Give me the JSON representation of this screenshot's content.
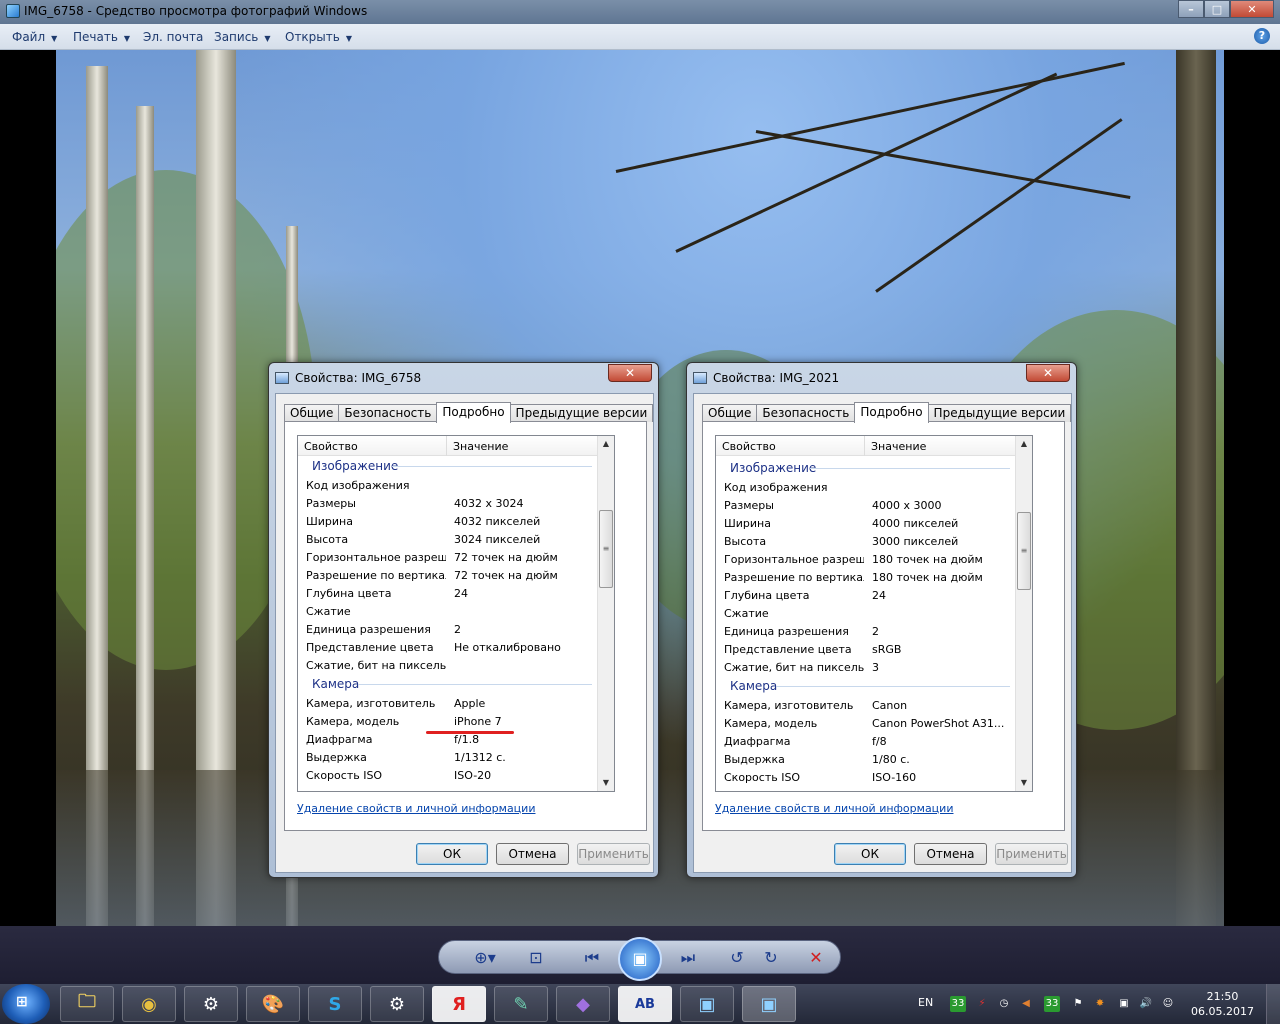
{
  "window": {
    "title": "IMG_6758 - Средство просмотра фотографий Windows",
    "controls": {
      "minimize": "–",
      "maximize": "□",
      "close": "✕"
    }
  },
  "menu": {
    "items": [
      {
        "label": "Файл",
        "has_arrow": true
      },
      {
        "label": "Печать",
        "has_arrow": true
      },
      {
        "label": "Эл. почта",
        "has_arrow": false
      },
      {
        "label": "Запись",
        "has_arrow": true
      },
      {
        "label": "Открыть",
        "has_arrow": true
      }
    ],
    "arrow_glyph": "▼",
    "help": "?"
  },
  "dialogs": [
    {
      "title": "Свойства: IMG_6758",
      "close": "✕",
      "tabs": [
        "Общие",
        "Безопасность",
        "Подробно",
        "Предыдущие версии"
      ],
      "active_tab": "Подробно",
      "columns": {
        "property": "Свойство",
        "value": "Значение"
      },
      "groups": [
        {
          "name": "Изображение",
          "rows": [
            {
              "k": "Код изображения",
              "v": ""
            },
            {
              "k": "Размеры",
              "v": "4032 x 3024"
            },
            {
              "k": "Ширина",
              "v": "4032 пикселей"
            },
            {
              "k": "Высота",
              "v": "3024 пикселей"
            },
            {
              "k": "Горизонтальное разреше...",
              "v": "72 точек на дюйм"
            },
            {
              "k": "Разрешение по вертикали",
              "v": "72 точек на дюйм"
            },
            {
              "k": "Глубина цвета",
              "v": "24"
            },
            {
              "k": "Сжатие",
              "v": ""
            },
            {
              "k": "Единица разрешения",
              "v": "2"
            },
            {
              "k": "Представление цвета",
              "v": "Не откалибровано"
            },
            {
              "k": "Сжатие, бит на пиксель",
              "v": ""
            }
          ]
        },
        {
          "name": "Камера",
          "rows": [
            {
              "k": "Камера, изготовитель",
              "v": "Apple"
            },
            {
              "k": "Камера, модель",
              "v": "iPhone 7"
            },
            {
              "k": "Диафрагма",
              "v": "f/1.8"
            },
            {
              "k": "Выдержка",
              "v": "1/1312 с."
            },
            {
              "k": "Скорость ISO",
              "v": "ISO-20"
            }
          ]
        }
      ],
      "link": "Удаление свойств и личной информации",
      "buttons": {
        "ok": "ОК",
        "cancel": "Отмена",
        "apply": "Применить"
      }
    },
    {
      "title": "Свойства: IMG_2021",
      "close": "✕",
      "tabs": [
        "Общие",
        "Безопасность",
        "Подробно",
        "Предыдущие версии"
      ],
      "active_tab": "Подробно",
      "columns": {
        "property": "Свойство",
        "value": "Значение"
      },
      "groups": [
        {
          "name": "Изображение",
          "rows": [
            {
              "k": "Код изображения",
              "v": ""
            },
            {
              "k": "Размеры",
              "v": "4000 x 3000"
            },
            {
              "k": "Ширина",
              "v": "4000 пикселей"
            },
            {
              "k": "Высота",
              "v": "3000 пикселей"
            },
            {
              "k": "Горизонтальное разреше...",
              "v": "180 точек на дюйм"
            },
            {
              "k": "Разрешение по вертикали",
              "v": "180 точек на дюйм"
            },
            {
              "k": "Глубина цвета",
              "v": "24"
            },
            {
              "k": "Сжатие",
              "v": ""
            },
            {
              "k": "Единица разрешения",
              "v": "2"
            },
            {
              "k": "Представление цвета",
              "v": "sRGB"
            },
            {
              "k": "Сжатие, бит на пиксель",
              "v": "3"
            }
          ]
        },
        {
          "name": "Камера",
          "rows": [
            {
              "k": "Камера, изготовитель",
              "v": "Canon"
            },
            {
              "k": "Камера, модель",
              "v": "Canon PowerShot A31..."
            },
            {
              "k": "Диафрагма",
              "v": "f/8"
            },
            {
              "k": "Выдержка",
              "v": "1/80 с."
            },
            {
              "k": "Скорость ISO",
              "v": "ISO-160"
            }
          ]
        }
      ],
      "link": "Удаление свойств и личной информации",
      "buttons": {
        "ok": "ОК",
        "cancel": "Отмена",
        "apply": "Применить"
      }
    }
  ],
  "viewer_toolbar": {
    "icons": [
      "zoom-icon",
      "fit-window-icon",
      "previous-icon",
      "slideshow-icon",
      "next-icon",
      "rotate-left-icon",
      "rotate-right-icon",
      "delete-icon"
    ],
    "glyphs": {
      "zoom": "⊕▾",
      "fit": "⊡",
      "prev": "⏮",
      "slideshow": "▣",
      "next": "⏭",
      "rotate_left": "↺",
      "rotate_right": "↻",
      "delete": "✕"
    }
  },
  "taskbar": {
    "start_glyph": "⊞",
    "apps": [
      {
        "name": "explorer",
        "glyph": "🗀"
      },
      {
        "name": "chrome",
        "glyph": "◉"
      },
      {
        "name": "steam",
        "glyph": "⚙"
      },
      {
        "name": "paint",
        "glyph": "🎨"
      },
      {
        "name": "skype",
        "glyph": "S"
      },
      {
        "name": "steam-alt",
        "glyph": "⚙"
      },
      {
        "name": "yandex",
        "glyph": "Я"
      },
      {
        "name": "notes",
        "glyph": "✎"
      },
      {
        "name": "visual-studio",
        "glyph": "◆"
      },
      {
        "name": "abc-net",
        "glyph": "AB"
      },
      {
        "name": "photo-viewer",
        "glyph": "▣"
      },
      {
        "name": "photo-viewer-active",
        "glyph": "▣"
      }
    ],
    "tray": {
      "lang": "EN",
      "icons": [
        "33",
        "⚡",
        "◷",
        "◀",
        "33",
        "⚑",
        "✸",
        "▣",
        "🔊",
        "☺"
      ],
      "time": "21:50",
      "date": "06.05.2017"
    }
  }
}
